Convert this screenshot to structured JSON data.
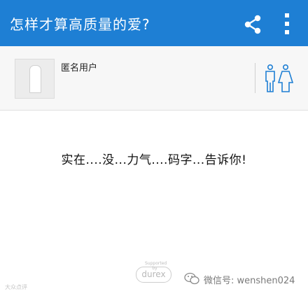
{
  "app_bar": {
    "title": "怎样才算高质量的爱?",
    "share_icon": "share-icon",
    "more_icon": "more-vertical-icon",
    "background": "#1e7fd4"
  },
  "answer_header": {
    "author": "匿名用户",
    "avatar_icon": "anonymous-avatar",
    "gender_icon": "male-female-icon",
    "icon_color": "#1e7fd4"
  },
  "answer": {
    "text": "实在....没...力气....码字...告诉你!"
  },
  "footer": {
    "sponsor_small": "Supported by",
    "sponsor_brand": "durex",
    "watermark_left": "大众点评",
    "wechat_icon": "wechat-icon",
    "watermark_right": "微信号: wenshen024"
  }
}
